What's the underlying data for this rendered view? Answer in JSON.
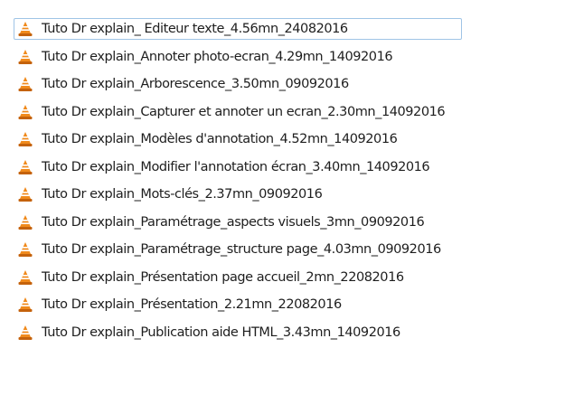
{
  "files": [
    {
      "name": "Tuto Dr explain_ Editeur texte_4.56mn_24082016",
      "icon": "vlc-cone-icon",
      "selected": true
    },
    {
      "name": "Tuto Dr explain_Annoter photo-ecran_4.29mn_14092016",
      "icon": "vlc-cone-icon",
      "selected": false
    },
    {
      "name": "Tuto Dr explain_Arborescence_3.50mn_09092016",
      "icon": "vlc-cone-icon",
      "selected": false
    },
    {
      "name": "Tuto Dr explain_Capturer et annoter un ecran_2.30mn_14092016",
      "icon": "vlc-cone-icon",
      "selected": false
    },
    {
      "name": "Tuto Dr explain_Modèles d'annotation_4.52mn_14092016",
      "icon": "vlc-cone-icon",
      "selected": false
    },
    {
      "name": "Tuto Dr explain_Modifier l'annotation écran_3.40mn_14092016",
      "icon": "vlc-cone-icon",
      "selected": false
    },
    {
      "name": "Tuto Dr explain_Mots-clés_2.37mn_09092016",
      "icon": "vlc-cone-icon",
      "selected": false
    },
    {
      "name": "Tuto Dr explain_Paramétrage_aspects visuels_3mn_09092016",
      "icon": "vlc-cone-icon",
      "selected": false
    },
    {
      "name": "Tuto Dr explain_Paramétrage_structure page_4.03mn_09092016",
      "icon": "vlc-cone-icon",
      "selected": false
    },
    {
      "name": "Tuto Dr explain_Présentation page accueil_2mn_22082016",
      "icon": "vlc-cone-icon",
      "selected": false
    },
    {
      "name": "Tuto Dr explain_Présentation_2.21mn_22082016",
      "icon": "vlc-cone-icon",
      "selected": false
    },
    {
      "name": "Tuto Dr explain_Publication aide HTML_3.43mn_14092016",
      "icon": "vlc-cone-icon",
      "selected": false
    }
  ],
  "colors": {
    "icon_orange": "#f08a1c",
    "icon_stripe": "#ffffff",
    "icon_base": "#c4620c",
    "selection_border": "#9fc4e6",
    "text": "#1e1e1e"
  }
}
